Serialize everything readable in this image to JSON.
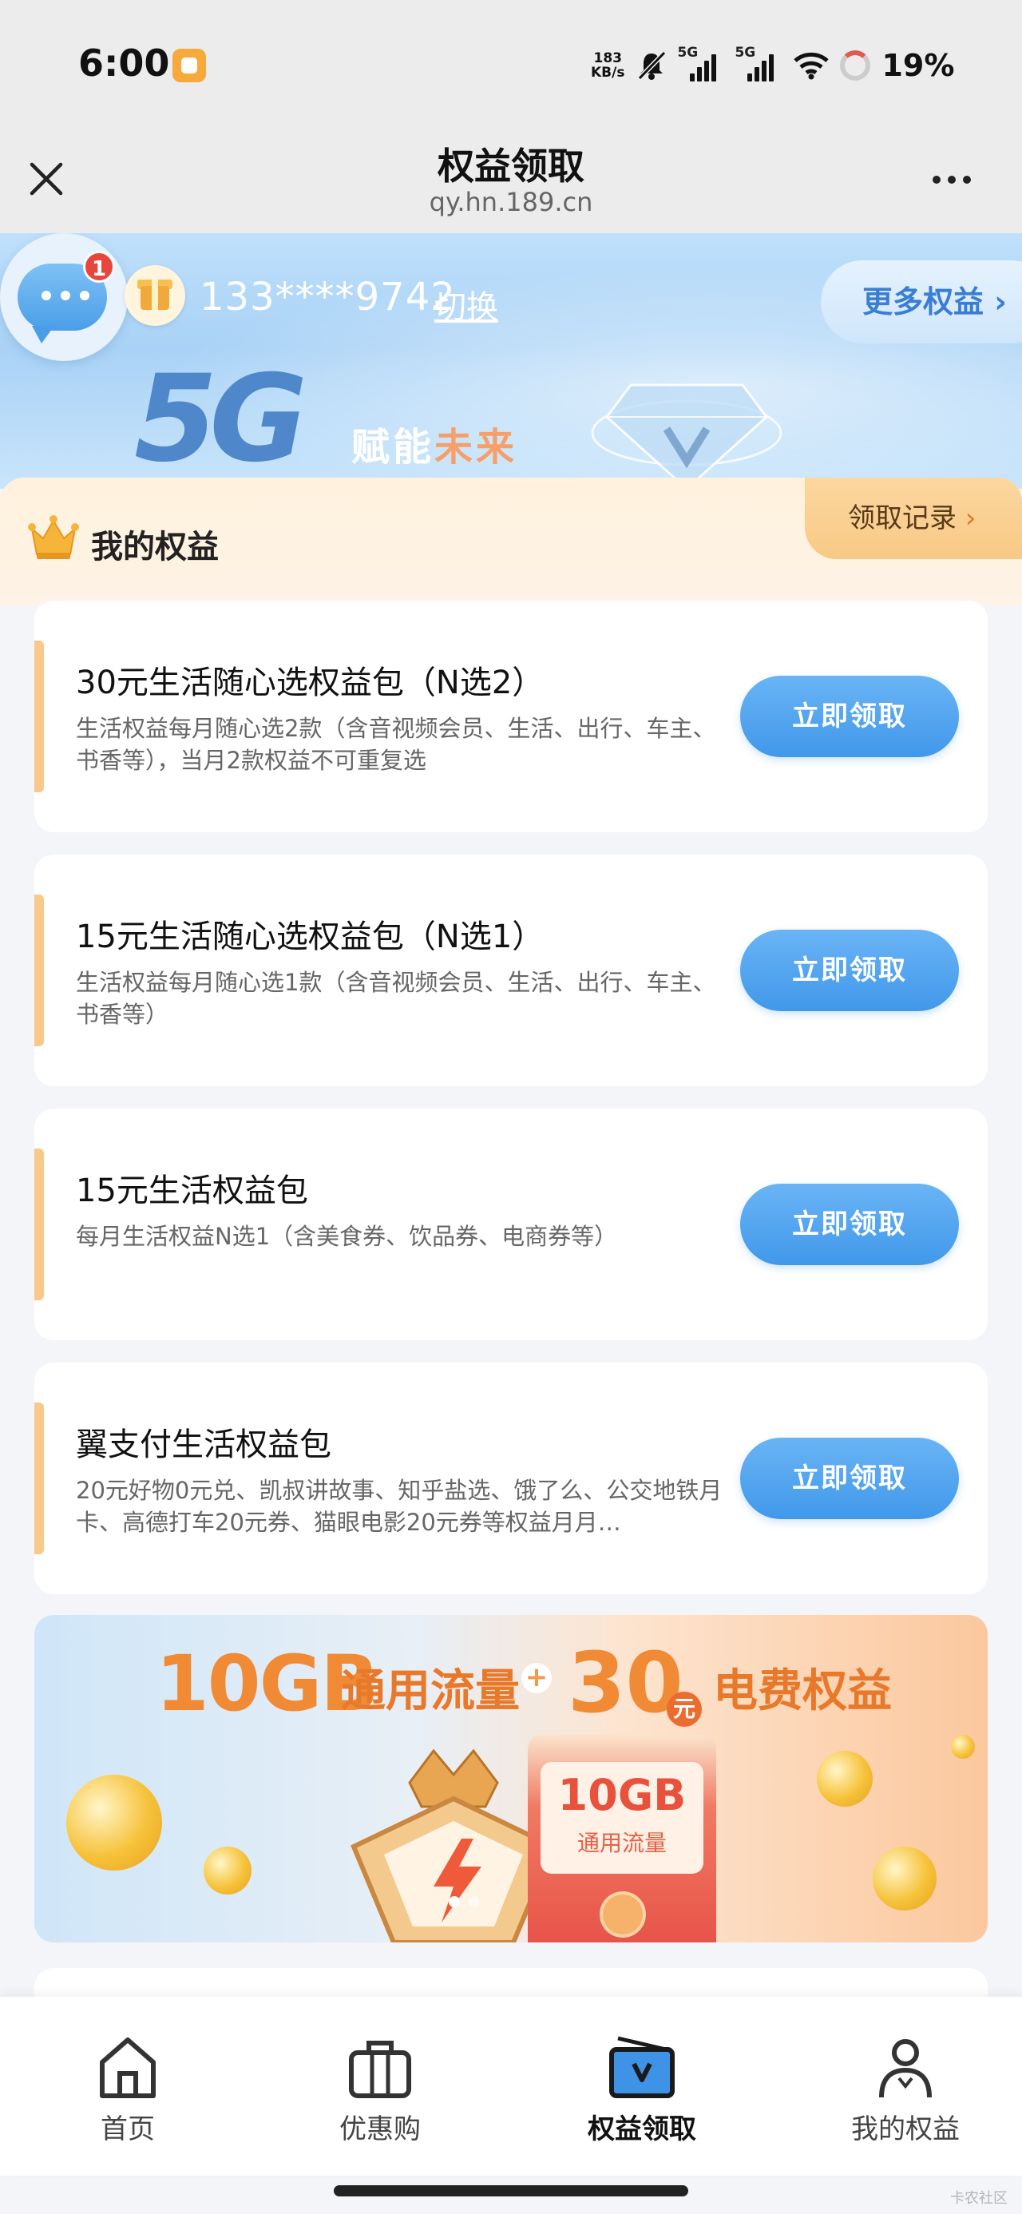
{
  "status_bar": {
    "time": "6:00",
    "net_speed_value": "183",
    "net_speed_unit": "KB/s",
    "signal1_label": "5G",
    "signal2_label": "5G",
    "battery": "19%"
  },
  "nav": {
    "title": "权益领取",
    "url": "qy.hn.189.cn"
  },
  "banner": {
    "chat_badge_count": "1",
    "phone_number": "133****9742",
    "switch_label": "切换",
    "more_benefits_label": "更多权益",
    "slogan_logo": "5G",
    "slogan_part1": "赋能",
    "slogan_part2": "未来"
  },
  "my_benefits": {
    "title": "我的权益",
    "records_label": "领取记录"
  },
  "benefits": [
    {
      "title": "30元生活随心选权益包（N选2）",
      "description": "生活权益每月随心选2款（含音视频会员、生活、出行、车主、书香等），当月2款权益不可重复选",
      "button": "立即领取"
    },
    {
      "title": "15元生活随心选权益包（N选1）",
      "description": "生活权益每月随心选1款（含音视频会员、生活、出行、车主、书香等）",
      "button": "立即领取"
    },
    {
      "title": "15元生活权益包",
      "description": "每月生活权益N选1（含美食券、饮品券、电商券等）",
      "button": "立即领取"
    },
    {
      "title": "翼支付生活权益包",
      "description": "20元好物0元兑、凯叔讲故事、知乎盐选、饿了么、公交地铁月卡、高德打车20元券、猫眼电影20元券等权益月月…",
      "button": "立即领取"
    }
  ],
  "promo": {
    "amount1": "10GB",
    "label1": "通用流量",
    "plus": "+",
    "amount2": "30",
    "yuan": "元",
    "label2": "电费权益",
    "card_amount": "10GB",
    "card_label": "通用流量"
  },
  "tabs": [
    {
      "label": "首页",
      "icon": "home-icon",
      "active": false
    },
    {
      "label": "优惠购",
      "icon": "briefcase-icon",
      "active": false
    },
    {
      "label": "权益领取",
      "icon": "benefits-tv-icon",
      "active": true
    },
    {
      "label": "我的权益",
      "icon": "user-icon",
      "active": false
    }
  ],
  "watermark": "卡农社区",
  "colors": {
    "accent_blue": "#4198ea",
    "card_accent": "#f9c98c",
    "badge_red": "#e8453c",
    "promo_orange": "#f08a35"
  }
}
